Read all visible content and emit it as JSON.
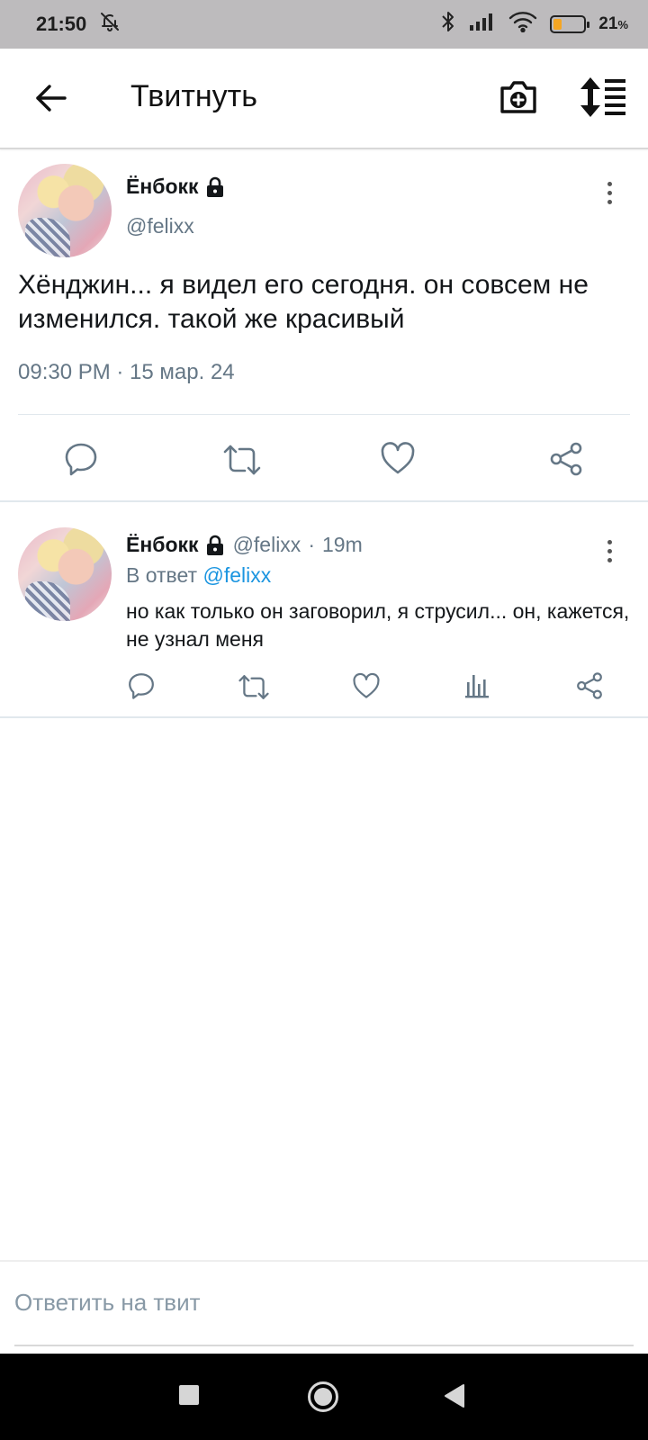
{
  "status_bar": {
    "time": "21:50",
    "battery_percent": "21",
    "battery_unit": "%",
    "icons": [
      "bell-off-icon",
      "bluetooth-icon",
      "signal-icon",
      "wifi-icon",
      "battery-icon"
    ]
  },
  "app_bar": {
    "title": "Твитнуть",
    "icons": [
      "back-arrow-icon",
      "camera-add-icon",
      "sort-icon"
    ]
  },
  "main_tweet": {
    "author_name": "Ёнбокк",
    "handle": "@felixx",
    "text": "Хёнджин... я видел его сегодня. он совсем не изменился. такой же красивый",
    "timestamp": "09:30 PM · 15 мар. 24",
    "actions": [
      "reply-icon",
      "retweet-icon",
      "like-icon",
      "share-icon"
    ]
  },
  "reply_tweet": {
    "author_name": "Ёнбокк",
    "handle": "@felixx",
    "separator": "·",
    "time": "19m",
    "in_reply_prefix": "В ответ",
    "in_reply_mention": "@felixx",
    "text": "но как только он заговорил, я струсил... он, кажется, не узнал меня",
    "actions": [
      "reply-icon",
      "retweet-icon",
      "like-icon",
      "stats-icon",
      "share-icon"
    ]
  },
  "reply_bar": {
    "placeholder": "Ответить на твит"
  },
  "nav_bar": {
    "buttons": [
      "recents-square-icon",
      "home-circle-icon",
      "back-triangle-icon"
    ]
  },
  "colors": {
    "status_bar_bg": "#bdbbbd",
    "text_primary": "#14171a",
    "text_secondary": "#657786",
    "link": "#1b95e0",
    "battery_fill": "#f5a623",
    "nav_bar_bg": "#000000"
  }
}
